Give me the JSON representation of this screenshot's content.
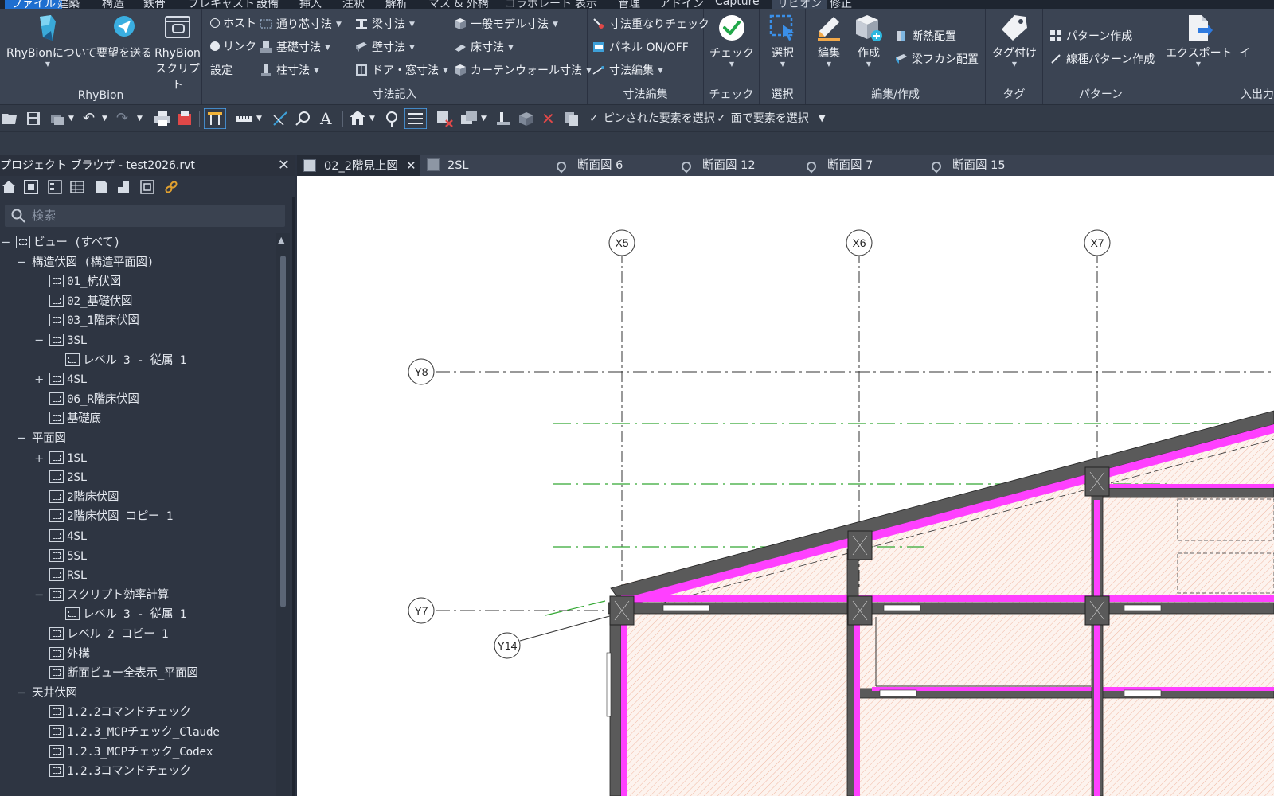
{
  "menu": {
    "items": [
      "ファイル",
      "建築",
      "構造",
      "鉄骨",
      "プレキャスト",
      "設備",
      "挿入",
      "注釈",
      "解析",
      "マス & 外構",
      "コラボレート",
      "表示",
      "管理",
      "アドイン",
      "Capture",
      "リビオン",
      "修正"
    ]
  },
  "ribbon": {
    "rhybion_panel": {
      "label": "RhyBion",
      "about": "RhyBionについて",
      "request": "要望を送る",
      "script": "RhyBion スクリプト"
    },
    "dimension_panel": {
      "label": "寸法記入",
      "host": "ホスト",
      "link": "リンク",
      "settings": "設定",
      "grid_dim": "通り芯寸法",
      "foundation_dim": "基礎寸法",
      "column_dim": "柱寸法",
      "beam_dim": "梁寸法",
      "wall_dim": "壁寸法",
      "door_window_dim": "ドア・窓寸法",
      "generic_model_dim": "一般モデル寸法",
      "floor_dim": "床寸法",
      "curtain_wall_dim": "カーテンウォール寸法"
    },
    "dimension_edit_panel": {
      "label": "寸法編集",
      "overlap_check": "寸法重なりチェック",
      "panel_toggle": "パネル ON/OFF",
      "dim_edit": "寸法編集"
    },
    "check_panel": {
      "label": "チェック",
      "check": "チェック"
    },
    "select_panel": {
      "label": "選択",
      "select": "選択"
    },
    "edit_create_panel": {
      "label": "編集/作成",
      "edit": "編集",
      "create": "作成",
      "insulation": "断熱配置",
      "beam_haunch": "梁フカシ配置"
    },
    "tag_panel": {
      "label": "タグ",
      "tag": "タグ付け"
    },
    "pattern_panel": {
      "label": "パターン",
      "pattern_create": "パターン作成",
      "linetype_pattern": "線種パターン作成"
    },
    "io_panel": {
      "label": "入出力",
      "export": "エクスポート",
      "import": "イ"
    }
  },
  "qat": {
    "pinned_select": "ピンされた要素を選択",
    "face_select": "面で要素を選択"
  },
  "browser": {
    "title": "プロジェクト ブラウザ - test2026.rvt",
    "search_placeholder": "検索",
    "tree": [
      {
        "depth": 0,
        "toggle": "−",
        "label": "ビュー (すべて)",
        "icon": true
      },
      {
        "depth": 1,
        "toggle": "−",
        "label": "構造伏図 (構造平面図)",
        "icon": false
      },
      {
        "depth": 2,
        "toggle": "",
        "label": "01_杭伏図",
        "icon": true
      },
      {
        "depth": 2,
        "toggle": "",
        "label": "02_基礎伏図",
        "icon": true
      },
      {
        "depth": 2,
        "toggle": "",
        "label": "03_1階床伏図",
        "icon": true
      },
      {
        "depth": 2,
        "toggle": "−",
        "label": "3SL",
        "icon": true
      },
      {
        "depth": 3,
        "toggle": "",
        "label": "レベル 3 - 従属 1",
        "icon": true
      },
      {
        "depth": 2,
        "toggle": "+",
        "label": "4SL",
        "icon": true
      },
      {
        "depth": 2,
        "toggle": "",
        "label": "06_R階床伏図",
        "icon": true
      },
      {
        "depth": 2,
        "toggle": "",
        "label": "基礎底",
        "icon": true
      },
      {
        "depth": 1,
        "toggle": "−",
        "label": "平面図",
        "icon": false
      },
      {
        "depth": 2,
        "toggle": "+",
        "label": "1SL",
        "icon": true
      },
      {
        "depth": 2,
        "toggle": "",
        "label": "2SL",
        "icon": true
      },
      {
        "depth": 2,
        "toggle": "",
        "label": "2階床伏図",
        "icon": true
      },
      {
        "depth": 2,
        "toggle": "",
        "label": "2階床伏図 コピー 1",
        "icon": true
      },
      {
        "depth": 2,
        "toggle": "",
        "label": "4SL",
        "icon": true
      },
      {
        "depth": 2,
        "toggle": "",
        "label": "5SL",
        "icon": true
      },
      {
        "depth": 2,
        "toggle": "",
        "label": "RSL",
        "icon": true
      },
      {
        "depth": 2,
        "toggle": "−",
        "label": "スクリプト効率計算",
        "icon": true
      },
      {
        "depth": 3,
        "toggle": "",
        "label": "レベル 3 - 従属 1",
        "icon": true
      },
      {
        "depth": 2,
        "toggle": "",
        "label": "レベル 2 コピー 1",
        "icon": true
      },
      {
        "depth": 2,
        "toggle": "",
        "label": "外構",
        "icon": true
      },
      {
        "depth": 2,
        "toggle": "",
        "label": "断面ビュー全表示_平面図",
        "icon": true
      },
      {
        "depth": 1,
        "toggle": "−",
        "label": "天井伏図",
        "icon": false
      },
      {
        "depth": 2,
        "toggle": "",
        "label": "1.2.2コマンドチェック",
        "icon": true
      },
      {
        "depth": 2,
        "toggle": "",
        "label": "1.2.3_MCPチェック_Claude",
        "icon": true
      },
      {
        "depth": 2,
        "toggle": "",
        "label": "1.2.3_MCPチェック_Codex",
        "icon": true
      },
      {
        "depth": 2,
        "toggle": "",
        "label": "1.2.3コマンドチェック",
        "icon": true
      }
    ]
  },
  "tabs": [
    {
      "label": "02_2階見上図",
      "active": true,
      "icon": "plan-view-icon"
    },
    {
      "label": "2SL",
      "active": false,
      "icon": "floor-plan-icon"
    },
    {
      "label": "断面図 6",
      "active": false,
      "icon": "section-icon"
    },
    {
      "label": "断面図 12",
      "active": false,
      "icon": "section-icon"
    },
    {
      "label": "断面図 7",
      "active": false,
      "icon": "section-icon"
    },
    {
      "label": "断面図 15",
      "active": false,
      "icon": "section-icon"
    }
  ],
  "drawing": {
    "grid_labels": {
      "x5": "X5",
      "x6": "X6",
      "x7": "X7",
      "y8": "Y8",
      "y7": "Y7",
      "y14": "Y14"
    },
    "colors": {
      "wall_magenta": "#ff40ff",
      "beam_dark": "#5a5a5a",
      "hatch": "#f3c4ad",
      "grid_green": "#33a833"
    }
  },
  "colors": {
    "accent": "#1f6fd0",
    "ribbon_bg": "#3b4453",
    "panel_bg": "#2e3542"
  }
}
